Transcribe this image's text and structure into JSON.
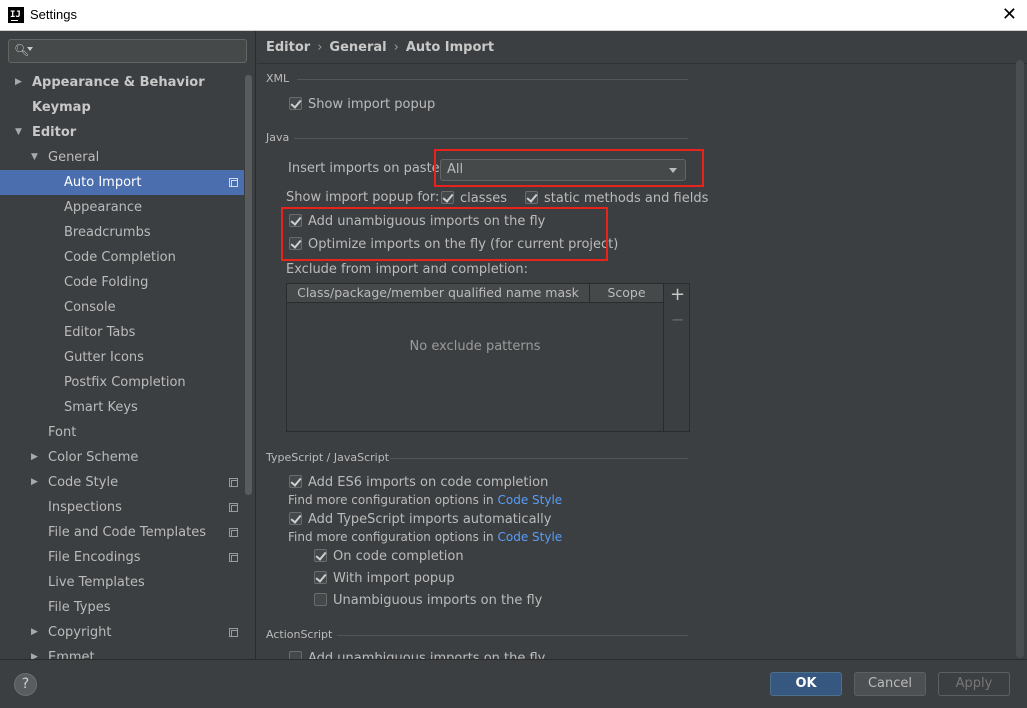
{
  "window": {
    "title": "Settings",
    "app_icon": "IJ",
    "close_glyph": "✕"
  },
  "search": {
    "placeholder": "",
    "value": ""
  },
  "sidebar": {
    "items": [
      {
        "label": "Appearance & Behavior",
        "level": 0,
        "arrow": "▶",
        "bold": true
      },
      {
        "label": "Keymap",
        "level": 0,
        "arrow": "",
        "bold": true
      },
      {
        "label": "Editor",
        "level": 0,
        "arrow": "▼",
        "bold": true
      },
      {
        "label": "General",
        "level": 1,
        "arrow": "▼"
      },
      {
        "label": "Auto Import",
        "level": 2,
        "selected": true,
        "project": true
      },
      {
        "label": "Appearance",
        "level": 2
      },
      {
        "label": "Breadcrumbs",
        "level": 2
      },
      {
        "label": "Code Completion",
        "level": 2
      },
      {
        "label": "Code Folding",
        "level": 2
      },
      {
        "label": "Console",
        "level": 2
      },
      {
        "label": "Editor Tabs",
        "level": 2
      },
      {
        "label": "Gutter Icons",
        "level": 2
      },
      {
        "label": "Postfix Completion",
        "level": 2
      },
      {
        "label": "Smart Keys",
        "level": 2
      },
      {
        "label": "Font",
        "level": 1
      },
      {
        "label": "Color Scheme",
        "level": 1,
        "arrow": "▶"
      },
      {
        "label": "Code Style",
        "level": 1,
        "arrow": "▶",
        "project": true
      },
      {
        "label": "Inspections",
        "level": 1,
        "project": true
      },
      {
        "label": "File and Code Templates",
        "level": 1,
        "project": true
      },
      {
        "label": "File Encodings",
        "level": 1,
        "project": true
      },
      {
        "label": "Live Templates",
        "level": 1
      },
      {
        "label": "File Types",
        "level": 1
      },
      {
        "label": "Copyright",
        "level": 1,
        "arrow": "▶",
        "project": true
      },
      {
        "label": "Emmet",
        "level": 1,
        "arrow": "▶"
      }
    ]
  },
  "breadcrumb": {
    "items": [
      "Editor",
      "General",
      "Auto Import"
    ],
    "separator": "›"
  },
  "xml": {
    "title": "XML",
    "show_import_popup": {
      "label": "Show import popup",
      "checked": true
    }
  },
  "java": {
    "title": "Java",
    "insert_imports_label": "Insert imports on paste:",
    "insert_imports_value": "All",
    "show_popup_for_label": "Show import popup for:",
    "classes": {
      "label": "classes",
      "checked": true
    },
    "static_methods": {
      "label": "static methods and fields",
      "checked": true
    },
    "add_unambiguous": {
      "label": "Add unambiguous imports on the fly",
      "checked": true
    },
    "optimize_imports": {
      "label": "Optimize imports on the fly (for current project)",
      "checked": true
    },
    "exclude_label": "Exclude from import and completion:",
    "table": {
      "columns": [
        "Class/package/member qualified name mask",
        "Scope"
      ],
      "empty_text": "No exclude patterns",
      "add_glyph": "+",
      "remove_glyph": "−"
    }
  },
  "typescript": {
    "title": "TypeScript / JavaScript",
    "es6": {
      "label": "Add ES6 imports on code completion",
      "checked": true
    },
    "find_more_1": "Find more configuration options in",
    "code_style_link_1": "Code Style",
    "ts_auto": {
      "label": "Add TypeScript imports automatically",
      "checked": true
    },
    "find_more_2": "Find more configuration options in",
    "code_style_link_2": "Code Style",
    "on_completion": {
      "label": "On code completion",
      "checked": true
    },
    "with_popup": {
      "label": "With import popup",
      "checked": true
    },
    "unambiguous": {
      "label": "Unambiguous imports on the fly",
      "checked": false
    }
  },
  "actionscript": {
    "title": "ActionScript",
    "partial_label": "Add unambiguous imports on the fly"
  },
  "buttons": {
    "help": "?",
    "ok": "OK",
    "cancel": "Cancel",
    "apply": "Apply"
  },
  "colors": {
    "background": "#3c3f41",
    "selection": "#4b6eaf",
    "highlight_box": "#e8231b",
    "link": "#589df6",
    "ok_button": "#365880"
  }
}
